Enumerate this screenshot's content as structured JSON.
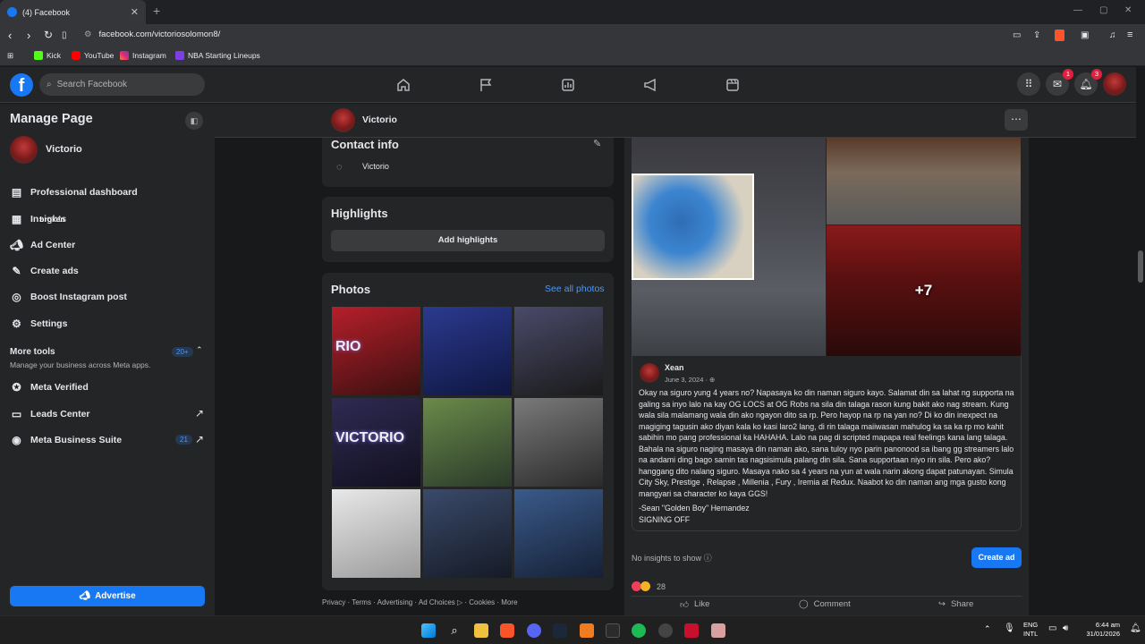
{
  "browser": {
    "tab_title": "(4) Facebook",
    "url_text": "facebook.com/victoriosolomon8/",
    "bookmarks": [
      "Kick",
      "YouTube",
      "Instagram",
      "NBA Starting Lineups"
    ]
  },
  "header": {
    "search_placeholder": "Search Facebook",
    "messenger_badge": "1",
    "notifications_badge": "3"
  },
  "sidebar": {
    "title": "Manage Page",
    "page_name": "Victorio",
    "items": [
      {
        "label": "Professional dashboard",
        "icon": "dashboard-icon"
      },
      {
        "label": "Insights",
        "icon": "insights-icon"
      },
      {
        "label": "Ad Center",
        "icon": "megaphone-icon"
      },
      {
        "label": "Create ads",
        "icon": "pencil-icon"
      },
      {
        "label": "Boost Instagram post",
        "icon": "instagram-icon"
      },
      {
        "label": "Settings",
        "icon": "gear-icon"
      }
    ],
    "insights_overlay": "broken",
    "more_tools": {
      "title": "More tools",
      "subtitle": "Manage your business across Meta apps.",
      "badge": "20+"
    },
    "tools": [
      {
        "label": "Meta Verified",
        "icon": "verified-icon"
      },
      {
        "label": "Leads Center",
        "icon": "leads-icon"
      },
      {
        "label": "Meta Business Suite",
        "icon": "business-suite-icon",
        "badge": "21"
      }
    ],
    "advertise_label": "Advertise"
  },
  "page_bar": {
    "name": "Victorio"
  },
  "contact": {
    "title": "Contact info",
    "messenger": "Victorio"
  },
  "highlights": {
    "title": "Highlights",
    "button": "Add highlights"
  },
  "photos": {
    "title": "Photos",
    "see_all": "See all photos",
    "tiles": [
      {
        "colors": [
          "#b51f2a",
          "#3b1010"
        ],
        "caption": "RIO"
      },
      {
        "colors": [
          "#2b3a8f",
          "#0f1640"
        ],
        "caption": ""
      },
      {
        "colors": [
          "#4a4a6a",
          "#1a1a1a"
        ],
        "caption": ""
      },
      {
        "colors": [
          "#2e2a52",
          "#12101f"
        ],
        "caption": "VICTORIO"
      },
      {
        "colors": [
          "#6b8a4a",
          "#2a3a2a"
        ],
        "caption": ""
      },
      {
        "colors": [
          "#7a7a7a",
          "#2a2a2a"
        ],
        "caption": ""
      },
      {
        "colors": [
          "#e8e8e8",
          "#9a9a9a"
        ],
        "caption": ""
      },
      {
        "colors": [
          "#3a4a6a",
          "#151a25"
        ],
        "caption": ""
      },
      {
        "colors": [
          "#3a5a8a",
          "#152035"
        ],
        "caption": ""
      }
    ]
  },
  "footer_links": "Privacy · Terms · Advertising · Ad Choices ▷ · Cookies · More",
  "post": {
    "more_count": "+7",
    "author": "Xean",
    "date": "June 3, 2024 · ",
    "body": "Okay na siguro yung 4 years no? Napasaya ko din naman siguro kayo. Salamat din sa lahat ng supporta na galing sa inyo lalo na kay OG LOCS at OG Robs na sila din talaga rason kung bakit ako nag stream. Kung wala sila malamang wala din ako ngayon dito sa rp. Pero hayop na rp na yan no? Di ko din inexpect na magiging tagusin ako diyan kala ko kasi laro2 lang, di rin talaga maiiwasan mahulog ka sa ka rp mo kahit sabihin mo pang professional ka HAHAHA. Lalo na pag di scripted mapapa real feelings kana lang talaga. Bahala na siguro naging masaya din naman ako, sana tuloy nyo parin panonood sa ibang gg streamers lalo na andami ding bago samin tas nagsisimula palang din sila. Sana supportaan niyo rin sila. Pero ako? hanggang dito nalang siguro. Masaya nako sa 4 years na yun at wala narin akong dapat patunayan. Simula City Sky, Prestige , Relapse , Millenia , Fury , Iremia at Redux. Naabot ko din naman ang mga gusto kong mangyari sa character ko kaya GGS!",
    "signature_1": "-Sean \"Golden Boy\" Hernandez",
    "signature_2": "SIGNING OFF",
    "no_insights": "No insights to show",
    "create_ad": "Create ad",
    "reaction_count": "28",
    "like": "Like",
    "comment": "Comment",
    "share": "Share"
  },
  "taskbar": {
    "lang_1": "ENG",
    "lang_2": "INTL",
    "time": "6:44 am",
    "date": "31/01/2026"
  }
}
